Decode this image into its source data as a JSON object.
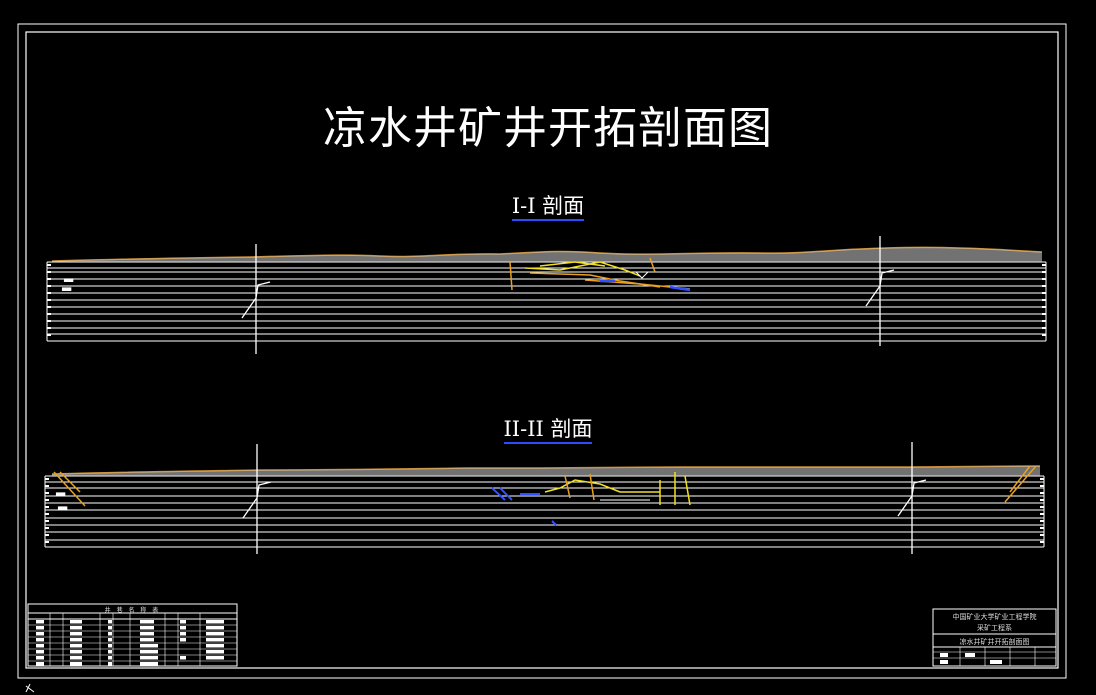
{
  "drawing": {
    "title": "凉水井矿井开拓剖面图",
    "sections": [
      {
        "label": "I-I 剖面"
      },
      {
        "label": "II-II 剖面"
      }
    ]
  },
  "legend_table": {
    "header": "井 巷 名 称 表"
  },
  "title_block": {
    "institution": "中国矿业大学矿业工程学院",
    "department": "采矿工程系",
    "drawing_name": "凉水井矿井开拓剖面图"
  },
  "colors": {
    "background": "#000000",
    "lines": "#ffffff",
    "surface": "#c98a2c",
    "workings_orange": "#e8a020",
    "workings_yellow": "#f0e020",
    "workings_blue": "#3050ff"
  }
}
